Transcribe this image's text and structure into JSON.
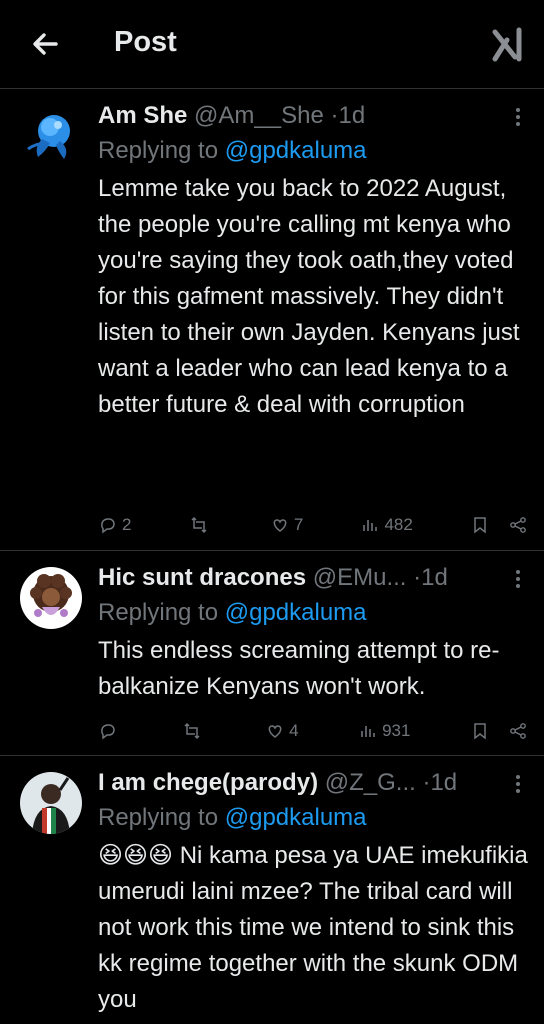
{
  "header": {
    "title": "Post",
    "back_icon": "arrow-left-icon",
    "grok_icon": "grok-icon"
  },
  "tweets": [
    {
      "name": "Am She",
      "handle": "@Am__She",
      "time": "1d",
      "replying_prefix": "Replying to",
      "replying_to": "@gpdkaluma",
      "text": "Lemme take you back to 2022 August, the people you're calling mt kenya who you're saying they took oath,they voted for this gafment massively. They didn't listen to their own Jayden. Kenyans just want a leader who can lead kenya to a better future & deal with corruption",
      "replies": "2",
      "reposts": "",
      "likes": "7",
      "views": "482"
    },
    {
      "name": "Hic sunt dracones",
      "handle": "@EMu...",
      "time": "1d",
      "replying_prefix": "Replying to",
      "replying_to": "@gpdkaluma",
      "text": "This endless screaming attempt to re-balkanize Kenyans won't work.",
      "replies": "",
      "reposts": "",
      "likes": "4",
      "views": "931"
    },
    {
      "name": "I am chege(parody)",
      "handle": "@Z_G...",
      "time": "1d",
      "replying_prefix": "Replying to",
      "replying_to": "@gpdkaluma",
      "text": "😆😆😆 Ni kama pesa ya UAE imekufikia umerudi laini mzee? The tribal card will not work this time we intend to sink this kk regime together with the skunk ODM you"
    }
  ],
  "colors": {
    "background": "#000000",
    "text": "#e7e9ea",
    "muted": "#71767b",
    "link": "#1d9bf0",
    "divider": "#2f3336"
  }
}
